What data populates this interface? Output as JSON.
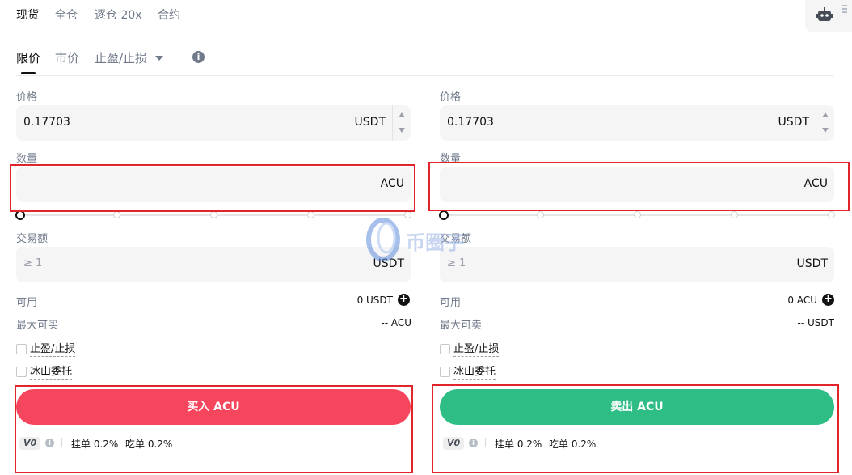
{
  "top_tabs": [
    "现货",
    "全仓",
    "逐仓 20x",
    "合约"
  ],
  "order_types": [
    "限价",
    "市价",
    "止盈/止损"
  ],
  "buy": {
    "price_label": "价格",
    "price_value": "0.17703",
    "price_unit": "USDT",
    "amount_label": "数量",
    "amount_unit": "ACU",
    "total_label": "交易额",
    "total_placeholder": "≥ 1",
    "total_unit": "USDT",
    "available_label": "可用",
    "available_value": "0 USDT",
    "max_label": "最大可买",
    "max_value": "-- ACU",
    "tp_sl_label": "止盈/止损",
    "iceberg_label": "冰山委托",
    "button_label": "买入 ACU",
    "vip": "V0",
    "maker_fee": "挂单 0.2%",
    "taker_fee": "吃单 0.2%"
  },
  "sell": {
    "price_label": "价格",
    "price_value": "0.17703",
    "price_unit": "USDT",
    "amount_label": "数量",
    "amount_unit": "ACU",
    "total_label": "交易额",
    "total_placeholder": "≥ 1",
    "total_unit": "USDT",
    "available_label": "可用",
    "available_value": "0 ACU",
    "max_label": "最大可卖",
    "max_value": "-- USDT",
    "tp_sl_label": "止盈/止损",
    "iceberg_label": "冰山委托",
    "button_label": "卖出 ACU",
    "vip": "V0",
    "maker_fee": "挂单 0.2%",
    "taker_fee": "吃单 0.2%"
  },
  "watermark_text": "币圈子",
  "colors": {
    "buy": "#f6465d",
    "sell": "#2ebd85",
    "highlight": "#e0262b"
  }
}
